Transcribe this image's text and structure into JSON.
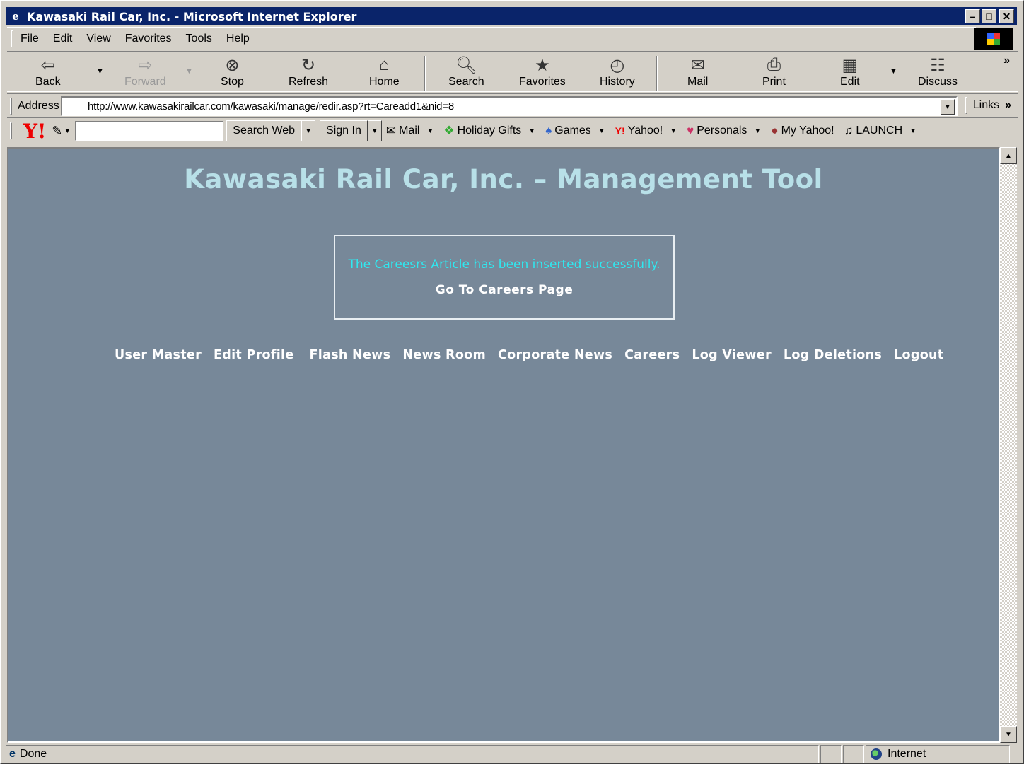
{
  "window": {
    "title": "Kawasaki Rail Car, Inc. - Microsoft Internet Explorer"
  },
  "menu": [
    "File",
    "Edit",
    "View",
    "Favorites",
    "Tools",
    "Help"
  ],
  "toolbar": {
    "back": "Back",
    "forward": "Forward",
    "stop": "Stop",
    "refresh": "Refresh",
    "home": "Home",
    "search": "Search",
    "favorites": "Favorites",
    "history": "History",
    "mail": "Mail",
    "print": "Print",
    "edit": "Edit",
    "discuss": "Discuss"
  },
  "address": {
    "label": "Address",
    "url": "http://www.kawasakirailcar.com/kawasaki/manage/redir.asp?rt=Careadd1&nid=8",
    "links_label": "Links"
  },
  "yahoo": {
    "logo": "Y!",
    "search_value": "",
    "search_button": "Search Web",
    "signin_button": "Sign In",
    "links": [
      "Mail",
      "Holiday Gifts",
      "Games",
      "Yahoo!",
      "Personals",
      "My Yahoo!",
      "LAUNCH"
    ]
  },
  "page": {
    "title": "Kawasaki Rail Car, Inc. – Management Tool",
    "message": "The Careesrs Article has been inserted successfully.",
    "go_link": "Go To Careers Page",
    "nav": [
      "User Master",
      "Edit Profile",
      "Flash News",
      "News Room",
      "Corporate News",
      "Careers",
      "Log Viewer",
      "Log Deletions",
      "Logout"
    ],
    "background_color": "#778899",
    "title_color": "#b8e0e8",
    "message_color": "#2fe8f0"
  },
  "status": {
    "text": "Done",
    "zone": "Internet"
  }
}
